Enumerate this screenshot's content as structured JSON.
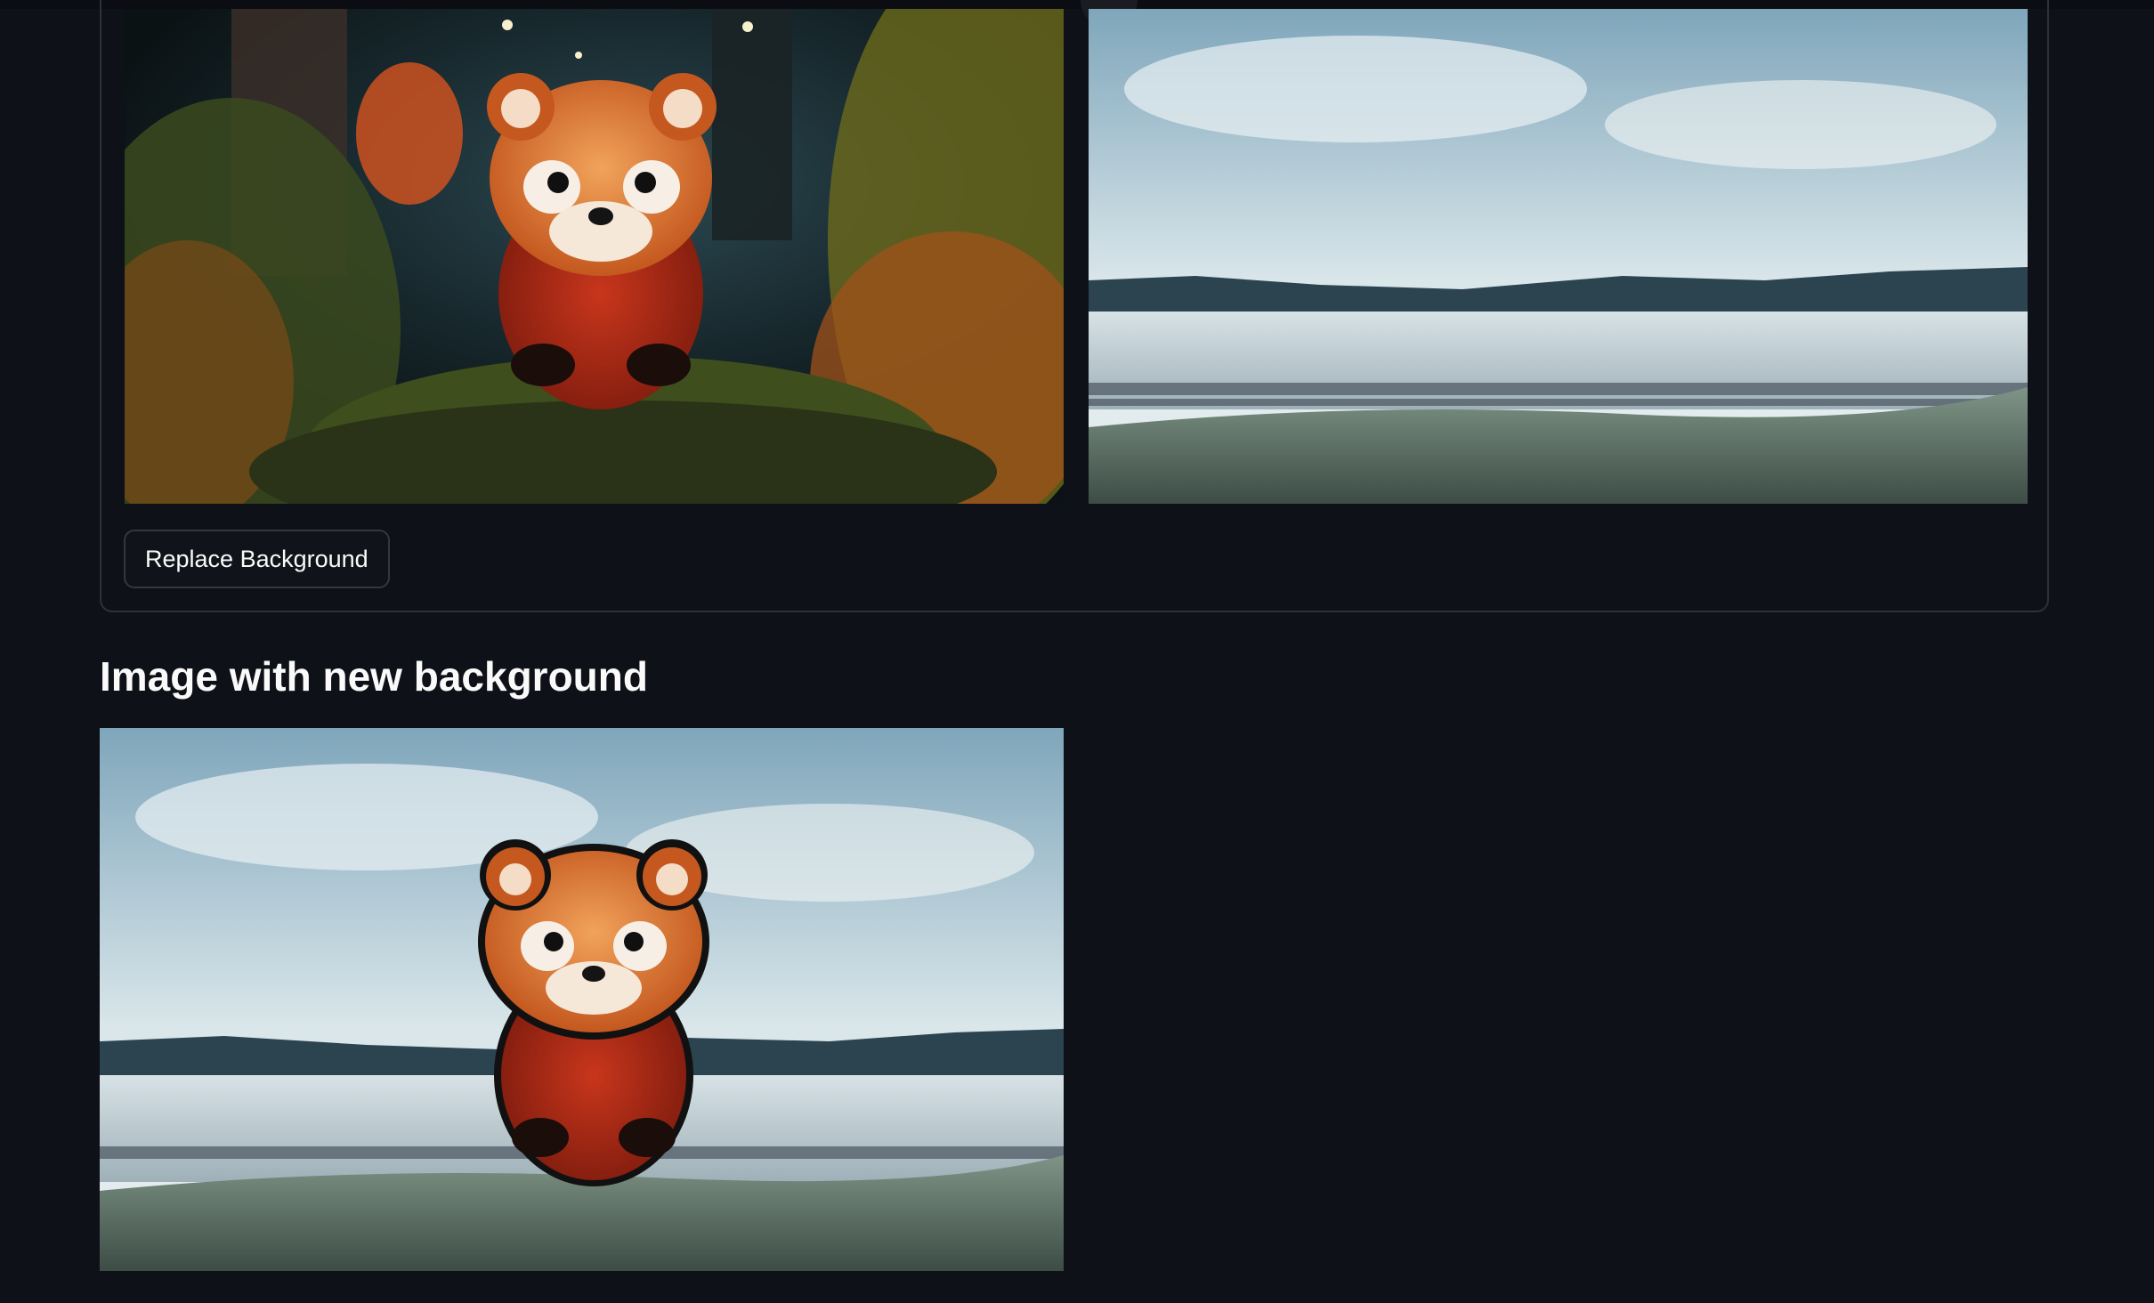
{
  "form": {
    "button_label": "Replace Background"
  },
  "images": {
    "source_image": "red panda sitting on a mossy rock in a forest at night",
    "background_image": "snow-dusted field landscape under a pale sky",
    "result_image": "red panda cut out and placed over the snowy field landscape"
  },
  "result": {
    "title": "Image with new background"
  },
  "colors": {
    "page_background": "#0e1117",
    "card_border": "#2c313c",
    "button_background": "#10131a",
    "button_border": "#33373f",
    "text": "#fafafa"
  }
}
